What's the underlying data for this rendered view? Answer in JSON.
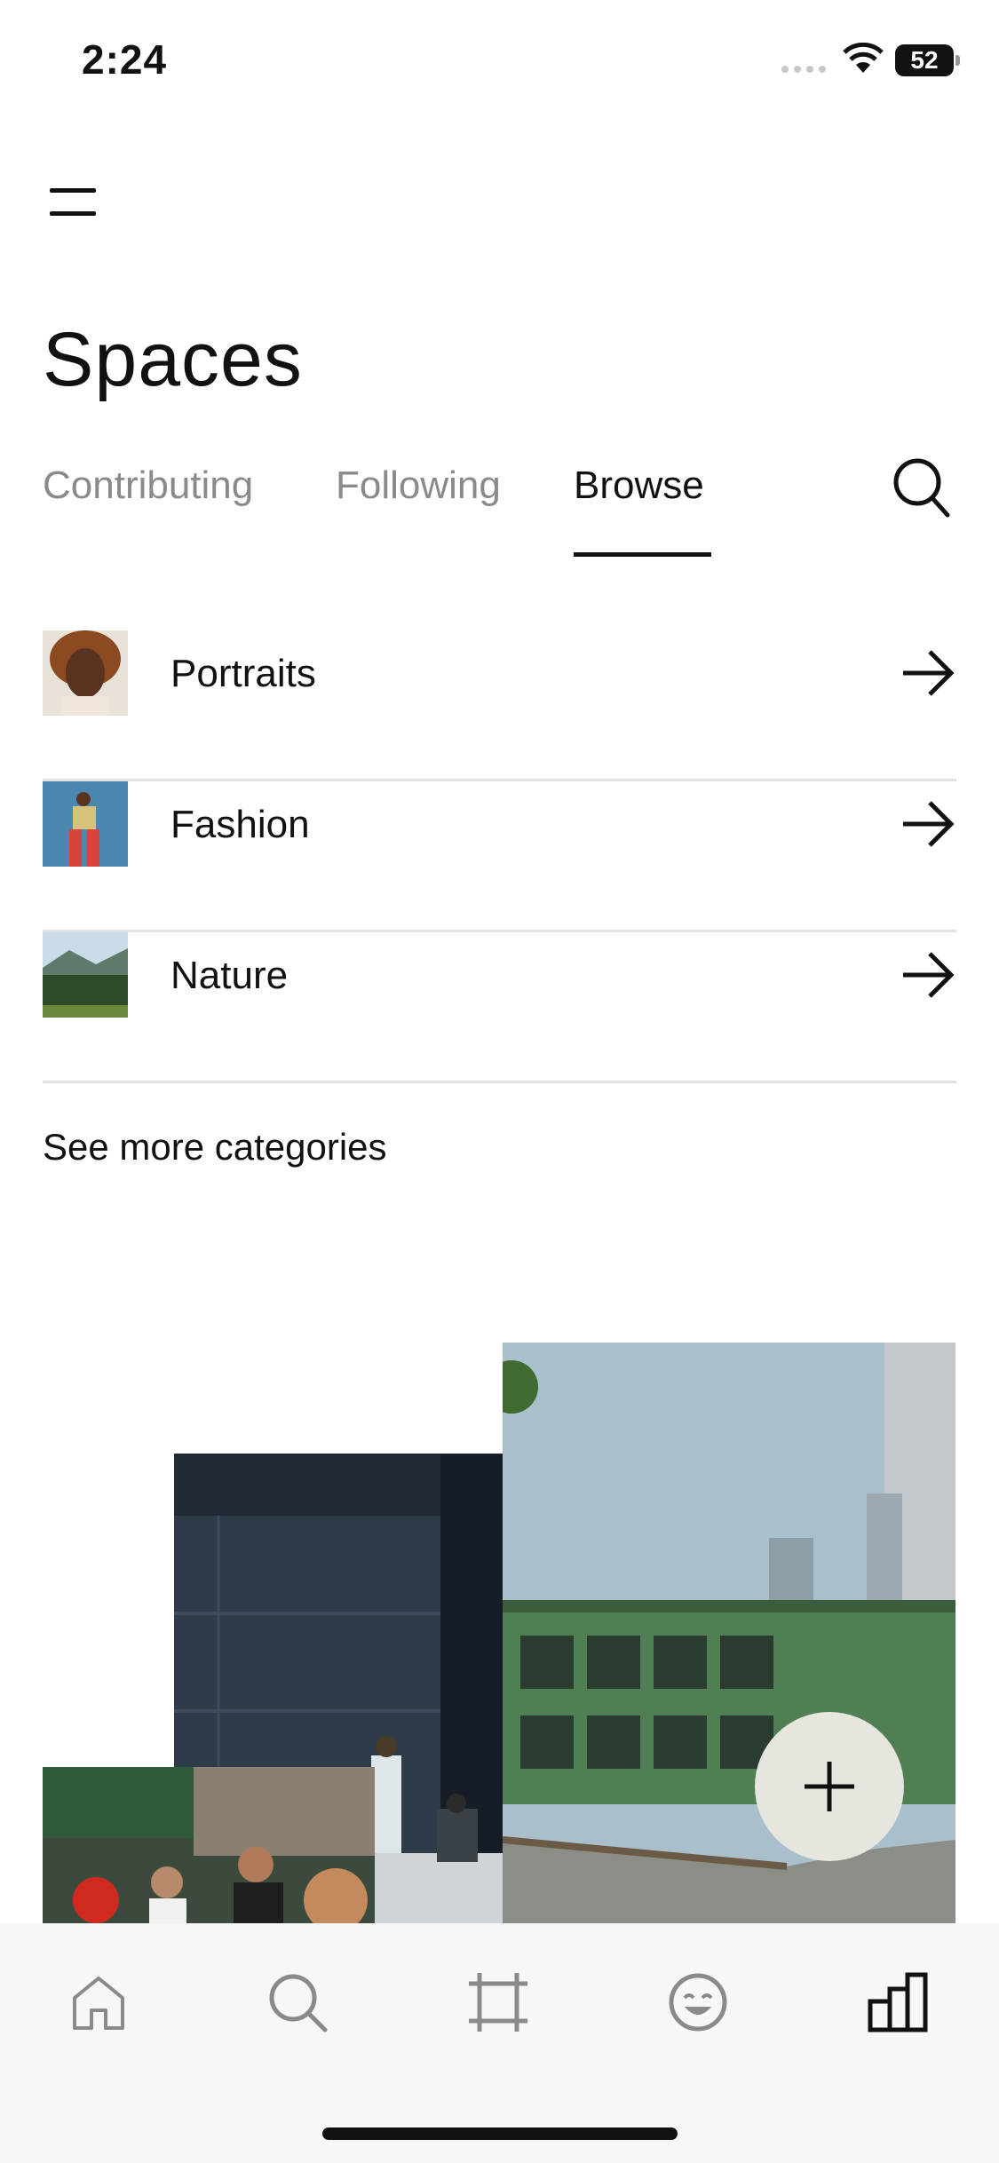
{
  "status_bar": {
    "time": "2:24",
    "battery": "52"
  },
  "header": {
    "title": "Spaces"
  },
  "tabs": [
    {
      "label": "Contributing",
      "active": false
    },
    {
      "label": "Following",
      "active": false
    },
    {
      "label": "Browse",
      "active": true
    }
  ],
  "categories": [
    {
      "label": "Portraits",
      "icon": "arrow-right-icon"
    },
    {
      "label": "Fashion",
      "icon": "arrow-right-icon"
    },
    {
      "label": "Nature",
      "icon": "arrow-right-icon"
    }
  ],
  "see_more": "See more categories",
  "bottom_nav": [
    {
      "name": "home",
      "icon": "home-icon"
    },
    {
      "name": "search",
      "icon": "search-icon"
    },
    {
      "name": "crop",
      "icon": "crop-icon"
    },
    {
      "name": "emoji",
      "icon": "smiley-icon"
    },
    {
      "name": "spaces",
      "icon": "spaces-icon",
      "active": true
    }
  ],
  "colors": {
    "active": "#111111",
    "inactive": "#8a8a8a",
    "fab": "#e6e6df",
    "nav_bg": "#f7f7f7"
  }
}
